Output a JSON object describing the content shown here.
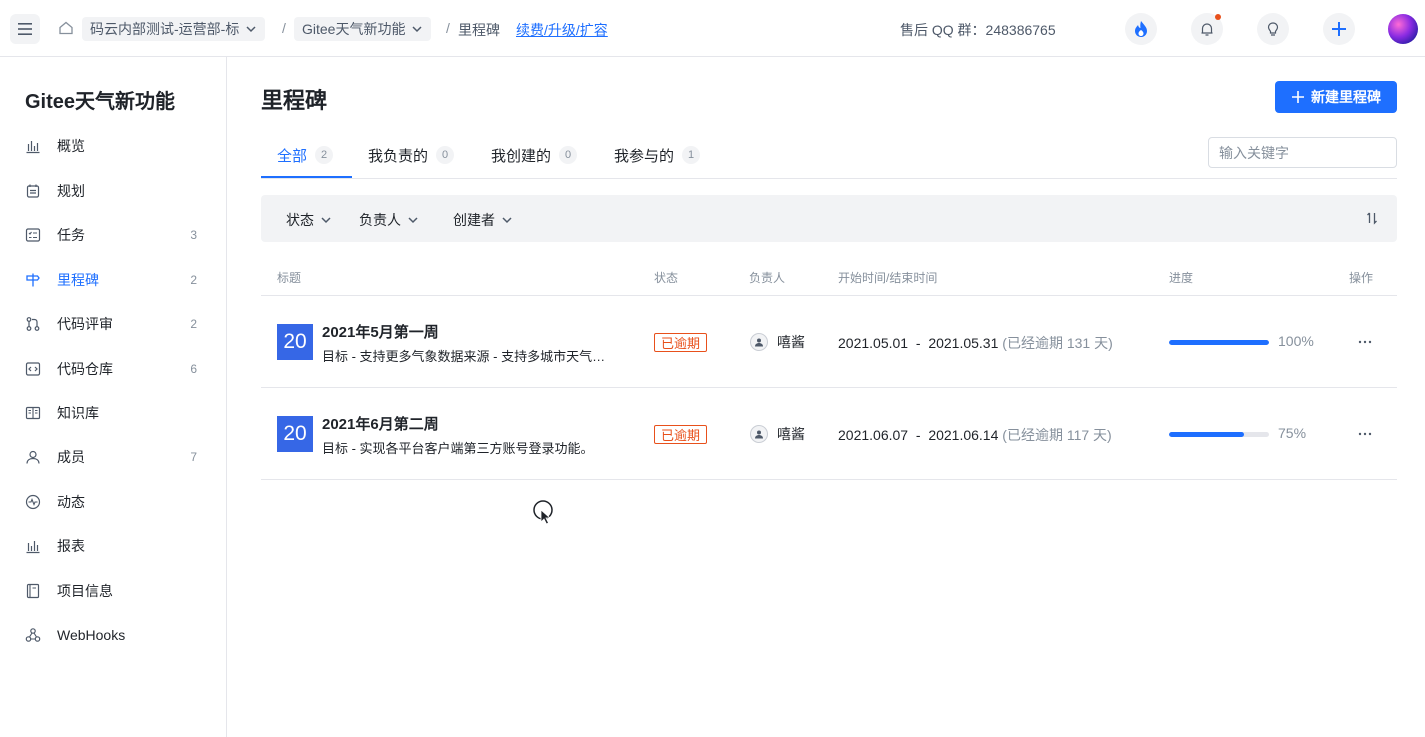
{
  "topbar": {
    "org_select": "码云内部测试-运营部-标",
    "project_select": "Gitee天气新功能",
    "breadcrumb_current": "里程碑",
    "upgrade_link": "续费/升级/扩容",
    "qq_group": "售后 QQ 群：248386765"
  },
  "sidebar": {
    "project_name": "Gitee天气新功能",
    "items": [
      {
        "label": "概览",
        "count": "",
        "icon": "bar-chart-icon"
      },
      {
        "label": "规划",
        "count": "",
        "icon": "calendar-icon"
      },
      {
        "label": "任务",
        "count": "3",
        "icon": "checklist-icon"
      },
      {
        "label": "里程碑",
        "count": "2",
        "icon": "milestone-icon",
        "active": true
      },
      {
        "label": "代码评审",
        "count": "2",
        "icon": "pull-request-icon"
      },
      {
        "label": "代码仓库",
        "count": "6",
        "icon": "code-icon"
      },
      {
        "label": "知识库",
        "count": "",
        "icon": "book-icon"
      },
      {
        "label": "成员",
        "count": "7",
        "icon": "user-icon"
      },
      {
        "label": "动态",
        "count": "",
        "icon": "activity-icon"
      },
      {
        "label": "报表",
        "count": "",
        "icon": "report-icon"
      },
      {
        "label": "项目信息",
        "count": "",
        "icon": "info-book-icon"
      },
      {
        "label": "WebHooks",
        "count": "",
        "icon": "webhook-icon"
      }
    ]
  },
  "main": {
    "title": "里程碑",
    "new_button": "新建里程碑",
    "tabs": [
      {
        "label": "全部",
        "count": "2"
      },
      {
        "label": "我负责的",
        "count": "0"
      },
      {
        "label": "我创建的",
        "count": "0"
      },
      {
        "label": "我参与的",
        "count": "1"
      }
    ],
    "search_placeholder": "输入关键字",
    "filters": [
      "状态",
      "负责人",
      "创建者"
    ],
    "columns": {
      "title": "标题",
      "status": "状态",
      "assignee": "负责人",
      "dates": "开始时间/结束时间",
      "progress": "进度",
      "actions": "操作"
    },
    "rows": [
      {
        "day": "20",
        "title": "2021年5月第一周",
        "desc": "目标 - 支持更多气象数据来源 - 支持多城市天气查询",
        "status": "已逾期",
        "assignee": "嘻酱",
        "start": "2021.05.01",
        "end": "2021.05.31",
        "overdue": "(已经逾期 131 天)",
        "progress_text": "100%",
        "progress": 1.0
      },
      {
        "day": "20",
        "title": "2021年6月第二周",
        "desc": "目标 - 实现各平台客户端第三方账号登录功能。",
        "status": "已逾期",
        "assignee": "嘻酱",
        "start": "2021.06.07",
        "end": "2021.06.14",
        "overdue": "(已经逾期 117 天)",
        "progress_text": "75%",
        "progress": 0.75
      }
    ]
  },
  "colors": {
    "accent": "#1e6fff",
    "overdue": "#e8501b",
    "date_badge": "#3667e6"
  }
}
